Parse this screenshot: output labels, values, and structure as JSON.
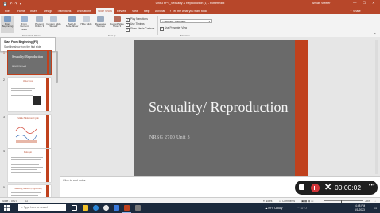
{
  "colors": {
    "accent": "#b7472a",
    "slide_bg": "#6a6a6a",
    "slide_accent": "#c0411d",
    "recording": "#d13438"
  },
  "titlebar": {
    "quick_access": "💾 ↶ ↷ ▾",
    "title": "Unit 3 PPT_Sexuality & Reproduction (1) - PowerPoint",
    "user": "Amilan Vreeler",
    "min": "—",
    "max": "☐",
    "close": "✕"
  },
  "tabs": [
    "File",
    "Home",
    "Insert",
    "Design",
    "Transitions",
    "Animations",
    "Slide Show",
    "Review",
    "View",
    "Help",
    "Acrobat"
  ],
  "active_tab": "Slide Show",
  "tell_me": "Tell me what you want to do",
  "share": "Share",
  "ribbon": {
    "buttons": [
      "From Beginning",
      "From Current Slide",
      "Present Online ▾",
      "Custom Slide Show ▾",
      "Set Up Slide Show",
      "Hide Slide",
      "Rehearse Timings",
      "Record Slide Show ▾"
    ],
    "checks": [
      "Play Narrations",
      "Use Timings",
      "Show Media Controls"
    ],
    "monitor_label": "Monitor:",
    "monitor_value": "Automatic",
    "presenter_view": "Use Presenter View",
    "groups": [
      "Start Slide Show",
      "Set Up",
      "Monitors"
    ]
  },
  "tooltip": {
    "title": "Start From Beginning (F5)",
    "body": "Start the show from the first slide."
  },
  "thumbnails": [
    {
      "num": "1",
      "title": "Sexuality/ Reproduction",
      "sub": "NRSG 2700 Unit 3"
    },
    {
      "num": "2",
      "title": "Objectives"
    },
    {
      "num": "3",
      "title": "Female Menstrual Cycle"
    },
    {
      "num": "4",
      "title": "Estrogen"
    },
    {
      "num": "5",
      "title": "Luteinizing Hormone (Progesterone)"
    }
  ],
  "slide": {
    "title": "Sexuality/ Reproduction",
    "subtitle": "NRSG 2700 Unit 3"
  },
  "notes_placeholder": "Click to add notes",
  "recording": {
    "time": "00:00:02",
    "x": "✕",
    "more": "•••"
  },
  "status": {
    "slide_count": "Slide 1 of 27",
    "notes": "Notes",
    "comments": "Comments",
    "zoom": "75%"
  },
  "taskbar": {
    "search": "Type here to search",
    "weather": "59°F Cloudy",
    "time": "4:48 PM",
    "date": "5/1/2023"
  }
}
